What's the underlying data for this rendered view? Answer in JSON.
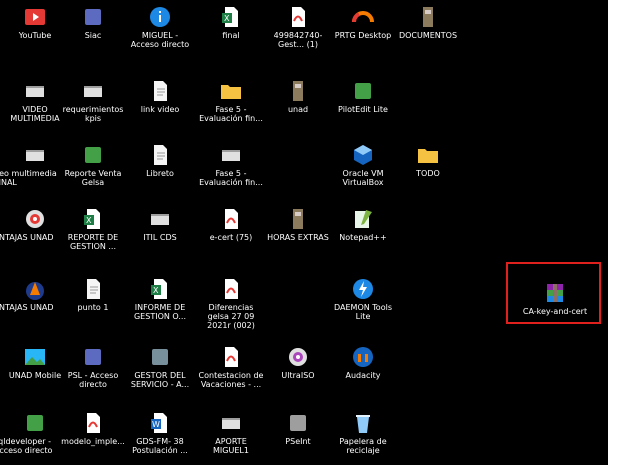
{
  "desktop": {
    "icons": [
      {
        "label": "YouTube",
        "icon": "youtube-icon",
        "color": "#e53935"
      },
      {
        "label": "Siac",
        "icon": "siac-app-icon",
        "color": "#5c6bc0"
      },
      {
        "label": "MIGUEL - Acceso directo",
        "icon": "info-shortcut-icon",
        "color": "#1e88e5"
      },
      {
        "label": "final",
        "icon": "excel-file-icon",
        "color": "#1e7e45"
      },
      {
        "label": "499842740-Gest... (1)",
        "icon": "pdf-file-icon",
        "color": "#e53935"
      },
      {
        "label": "PRTG Desktop",
        "icon": "prtg-gauge-icon",
        "color": "#f57c00"
      },
      {
        "label": "DOCUMENTOS",
        "icon": "cabinet-folder-icon",
        "color": "#8d7b5e"
      },
      {
        "label": "VIDEO MULTIMEDIA",
        "icon": "video-file-icon",
        "color": "#e0e0e0"
      },
      {
        "label": "requerimientos kpis",
        "icon": "video-file-icon",
        "color": "#e0e0e0"
      },
      {
        "label": "link video",
        "icon": "text-file-icon",
        "color": "#f5f5f5"
      },
      {
        "label": "Fase 5 - Evaluación fin...",
        "icon": "folder-icon",
        "color": "#f5c242"
      },
      {
        "label": "unad",
        "icon": "cabinet-folder-icon",
        "color": "#8d7b5e"
      },
      {
        "label": "PilotEdit Lite",
        "icon": "piloteedit-icon",
        "color": "#43a047"
      },
      {
        "label": "deo multimedia FINAL",
        "icon": "video-file-icon",
        "color": "#e0e0e0"
      },
      {
        "label": "Reporte Venta Gelsa",
        "icon": "check-shortcut-icon",
        "color": "#43a047"
      },
      {
        "label": "Libreto",
        "icon": "document-icon",
        "color": "#f5f5f5"
      },
      {
        "label": "Fase 5 - Evaluación fin...",
        "icon": "video-file-icon",
        "color": "#e0e0e0"
      },
      {
        "label": "Oracle VM VirtualBox",
        "icon": "virtualbox-icon",
        "color": "#1565c0"
      },
      {
        "label": "TODO",
        "icon": "folder-icon",
        "color": "#f5c242"
      },
      {
        "label": "ENTAJAS UNAD",
        "icon": "media-disc-icon",
        "color": "#e53935"
      },
      {
        "label": "REPORTE DE GESTION ...",
        "icon": "excel-file-icon",
        "color": "#1e7e45"
      },
      {
        "label": "ITIL CDS",
        "icon": "video-file-icon",
        "color": "#e0e0e0"
      },
      {
        "label": "e-cert (75)",
        "icon": "pdf-file-icon",
        "color": "#e53935"
      },
      {
        "label": "HORAS EXTRAS",
        "icon": "cabinet-folder-icon",
        "color": "#8d7b5e"
      },
      {
        "label": "Notepad++",
        "icon": "notepadpp-icon",
        "color": "#7cb342"
      },
      {
        "label": "ENTAJAS UNAD",
        "icon": "vlc-cone-icon",
        "color": "#f57c00"
      },
      {
        "label": "punto 1",
        "icon": "text-file-icon",
        "color": "#f5f5f5"
      },
      {
        "label": "INFORME DE GESTION O...",
        "icon": "excel-file-icon",
        "color": "#1e7e45"
      },
      {
        "label": "Diferencias gelsa 27 09 2021r (002)",
        "icon": "pdf-file-icon",
        "color": "#e53935"
      },
      {
        "label": "DAEMON Tools Lite",
        "icon": "daemon-tools-icon",
        "color": "#1e88e5"
      },
      {
        "label": "CA-key-and-cert",
        "icon": "winrar-archive-icon",
        "color": "#8e24aa"
      },
      {
        "label": "UNAD Mobile",
        "icon": "landscape-image-icon",
        "color": "#29b6f6"
      },
      {
        "label": "PSL - Acceso directo",
        "icon": "network-shortcut-icon",
        "color": "#5c6bc0"
      },
      {
        "label": "GESTOR DEL SERVICIO - A...",
        "icon": "people-shortcut-icon",
        "color": "#78909c"
      },
      {
        "label": "Contestacion de Vacaciones - ...",
        "icon": "pdf-file-icon",
        "color": "#e53935"
      },
      {
        "label": "UltraISO",
        "icon": "ultraiso-disc-icon",
        "color": "#ab47bc"
      },
      {
        "label": "Audacity",
        "icon": "audacity-icon",
        "color": "#1565c0"
      },
      {
        "label": "sqldeveloper - Acceso directo",
        "icon": "sqldeveloper-icon",
        "color": "#43a047"
      },
      {
        "label": "modelo_imple...",
        "icon": "pdf-file-icon",
        "color": "#e53935"
      },
      {
        "label": "GDS-FM- 38 Postulación ...",
        "icon": "word-file-icon",
        "color": "#1565c0"
      },
      {
        "label": "APORTE MIGUEL1",
        "icon": "video-file-icon",
        "color": "#e0e0e0"
      },
      {
        "label": "PSeInt",
        "icon": "pseint-icon",
        "color": "#9e9e9e"
      },
      {
        "label": "Papelera de reciclaje",
        "icon": "recycle-bin-icon",
        "color": "#90caf9"
      }
    ]
  },
  "highlight": {
    "color": "#e0201c",
    "target": "CA-key-and-cert"
  }
}
